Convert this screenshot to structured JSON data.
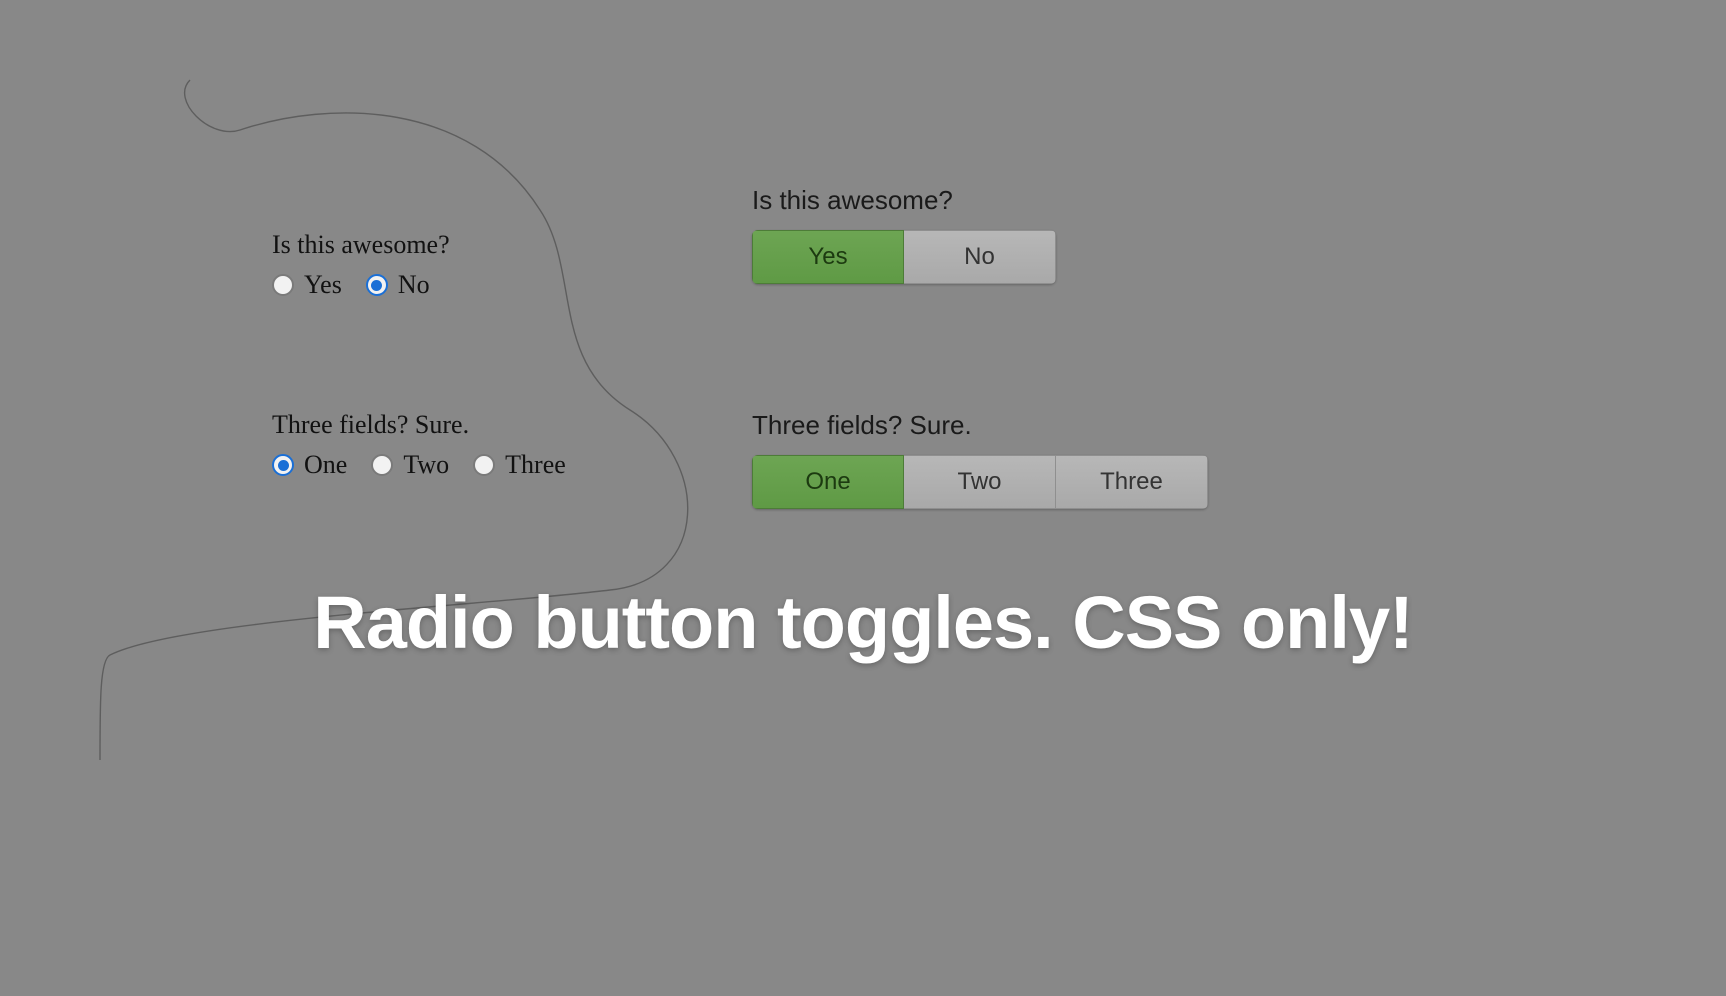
{
  "banner": "Radio button toggles. CSS only!",
  "group1": {
    "question": "Is this awesome?",
    "options": [
      {
        "label": "Yes",
        "native_checked": false,
        "toggle_active": true
      },
      {
        "label": "No",
        "native_checked": true,
        "toggle_active": false
      }
    ]
  },
  "group2": {
    "question": "Three fields? Sure.",
    "options": [
      {
        "label": "One",
        "native_checked": true,
        "toggle_active": true
      },
      {
        "label": "Two",
        "native_checked": false,
        "toggle_active": false
      },
      {
        "label": "Three",
        "native_checked": false,
        "toggle_active": false
      }
    ]
  },
  "colors": {
    "accent_blue": "#1a6fd6",
    "accent_green": "#5f9a45",
    "background": "#888888"
  }
}
